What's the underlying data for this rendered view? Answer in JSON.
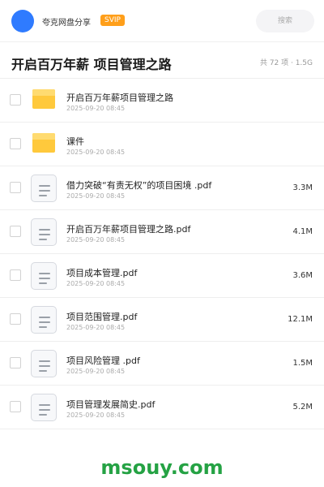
{
  "header": {
    "app_title": "夸克网盘分享",
    "badge": "SVIP",
    "search_placeholder": "搜索"
  },
  "folder": {
    "title": "开启百万年薪 项目管理之路",
    "meta": "共 72 项 · 1.5G"
  },
  "files": [
    {
      "type": "folder",
      "icon": "folder-icon",
      "name": "开启百万年薪项目管理之路",
      "date": "2025-09-20 08:45",
      "size": ""
    },
    {
      "type": "folder",
      "icon": "folder-icon",
      "name": "课件",
      "date": "2025-09-20 08:45",
      "size": ""
    },
    {
      "type": "file",
      "icon": "document-icon",
      "name": "借力突破“有责无权”的项目困境 .pdf",
      "date": "2025-09-20 08:45",
      "size": "3.3M"
    },
    {
      "type": "file",
      "icon": "document-icon",
      "name": "开启百万年薪项目管理之路.pdf",
      "date": "2025-09-20 08:45",
      "size": "4.1M"
    },
    {
      "type": "file",
      "icon": "document-icon",
      "name": "项目成本管理.pdf",
      "date": "2025-09-20 08:45",
      "size": "3.6M"
    },
    {
      "type": "file",
      "icon": "document-icon",
      "name": "项目范围管理.pdf",
      "date": "2025-09-20 08:45",
      "size": "12.1M"
    },
    {
      "type": "file",
      "icon": "document-icon",
      "name": "项目风险管理 .pdf",
      "date": "2025-09-20 08:45",
      "size": "1.5M"
    },
    {
      "type": "file",
      "icon": "document-icon",
      "name": "项目管理发展简史.pdf",
      "date": "2025-09-20 08:45",
      "size": "5.2M"
    }
  ],
  "watermark": "msouy.com",
  "colors": {
    "avatar": "#2f7bff",
    "badge": "#ff9f1a",
    "folder": "#ffc93c",
    "watermark": "#25a244"
  }
}
